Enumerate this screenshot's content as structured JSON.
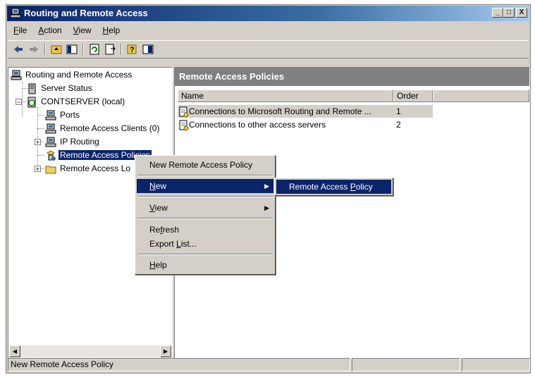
{
  "window": {
    "title": "Routing and Remote Access",
    "minimize": "_",
    "maximize": "□",
    "close": "X"
  },
  "menubar": {
    "items": [
      {
        "label_first": "F",
        "label_rest": "ile"
      },
      {
        "label_first": "A",
        "label_rest": "ction"
      },
      {
        "label_first": "V",
        "label_rest": "iew"
      },
      {
        "label_first": "H",
        "label_rest": "elp"
      }
    ]
  },
  "tree": {
    "root": "Routing and Remote Access",
    "server_status": "Server Status",
    "server": "CONTSERVER (local)",
    "ports": "Ports",
    "clients": "Remote Access Clients (0)",
    "ip_routing": "IP Routing",
    "policies": "Remote Access Policies",
    "logging": "Remote Access Lo"
  },
  "right_pane": {
    "header": "Remote Access Policies",
    "columns": [
      "Name",
      "Order"
    ],
    "rows": [
      {
        "name": "Connections to Microsoft Routing and Remote ...",
        "order": "1"
      },
      {
        "name": "Connections to other access servers",
        "order": "2"
      }
    ]
  },
  "context_menu": {
    "new_policy": "New Remote Access Policy",
    "new": {
      "first": "N",
      "rest": "ew"
    },
    "view": {
      "first": "V",
      "rest": "iew"
    },
    "refresh": {
      "pre": "Re",
      "u": "f",
      "rest": "resh"
    },
    "export": {
      "pre": "Export ",
      "u": "L",
      "rest": "ist..."
    },
    "help": {
      "first": "H",
      "rest": "elp"
    }
  },
  "submenu": {
    "pre": "Remote Access ",
    "u": "P",
    "rest": "olicy"
  },
  "statusbar": {
    "text": "New Remote Access Policy"
  },
  "colors": {
    "selection": "#0a246a",
    "header_gray": "#808080",
    "face": "#d4d0c8"
  }
}
